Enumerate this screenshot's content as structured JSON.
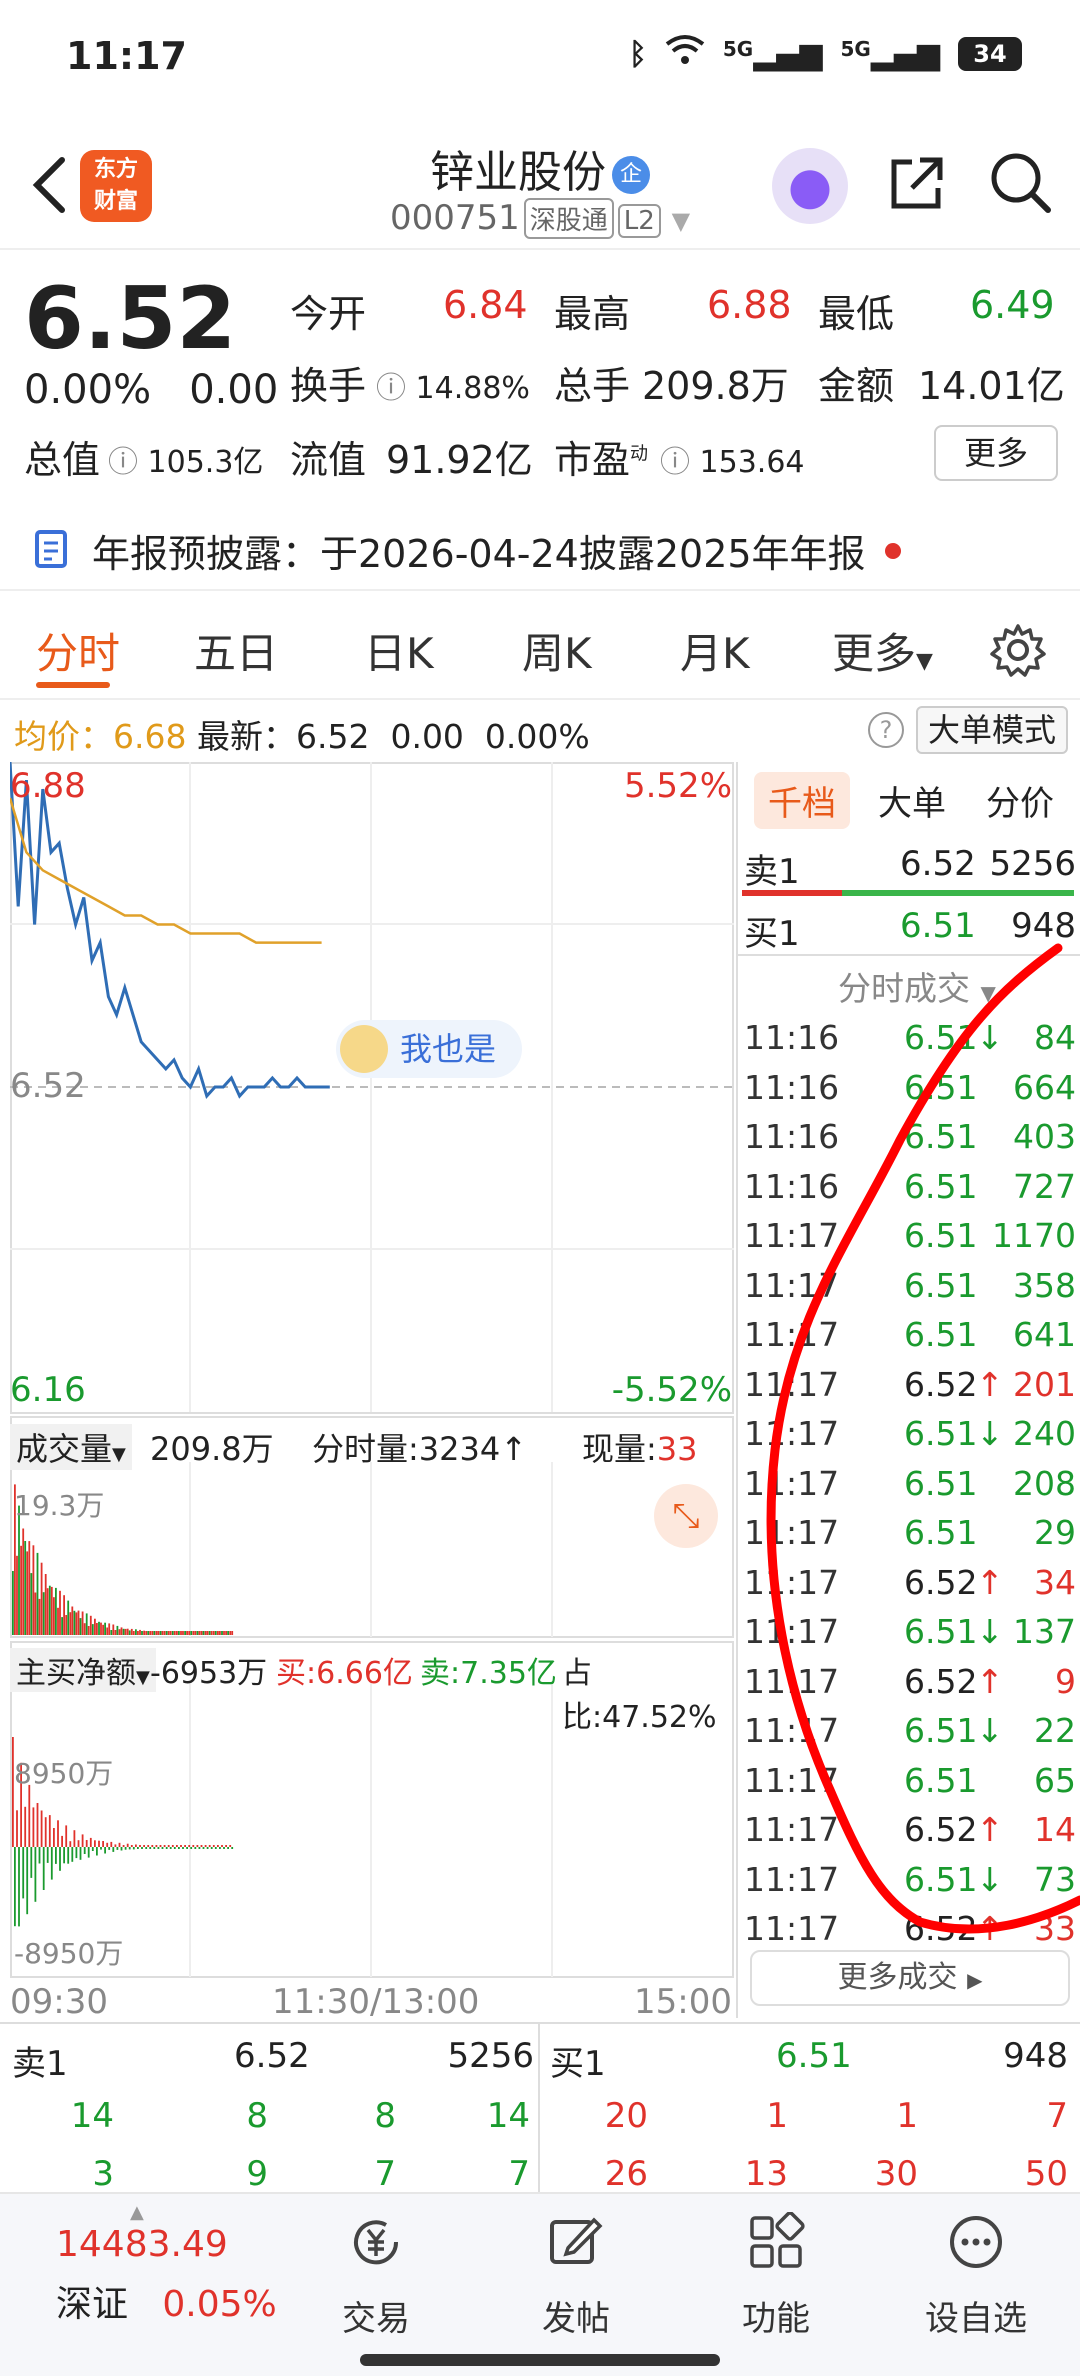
{
  "status_bar": {
    "time": "11:17",
    "signal1": "5G",
    "signal2": "5G",
    "battery": "34"
  },
  "header": {
    "logo_line1": "东方",
    "logo_line2": "财富",
    "stock_name": "锌业股份",
    "badge": "企",
    "stock_code": "000751",
    "market_tag": "深股通",
    "level_tag": "L2"
  },
  "quote": {
    "price": "6.52",
    "change_pct": "0.00%",
    "change": "0.00",
    "open_label": "今开",
    "open": "6.84",
    "high_label": "最高",
    "high": "6.88",
    "low_label": "最低",
    "low": "6.49",
    "turnover_label": "换手",
    "turnover": "14.88%",
    "volume_label": "总手",
    "volume": "209.8万",
    "amount_label": "金额",
    "amount": "14.01亿",
    "mktcap_label": "总值",
    "mktcap": "105.3亿",
    "float_label": "流值",
    "float": "91.92亿",
    "pe_label": "市盈",
    "pe_sup": "动",
    "pe": "153.64",
    "more": "更多"
  },
  "notice": {
    "text": "年报预披露：于2026-04-24披露2025年年报"
  },
  "tabs": [
    "分时",
    "五日",
    "日K",
    "周K",
    "月K",
    "更多"
  ],
  "avgbar": {
    "avg_label": "均价：",
    "avg": "6.68",
    "latest_label": "最新：",
    "latest": "6.52",
    "chg": "0.00",
    "pct": "0.00%",
    "mode_button": "大单模式"
  },
  "chart_labels": {
    "top_price": "6.88",
    "top_pct": "5.52%",
    "mid_price": "6.52",
    "bottom_price": "6.16",
    "bottom_pct": "-5.52%",
    "bubble": "我也是",
    "vol_selector": "成交量",
    "vol_total": "209.8万",
    "vol_minute": "分时量:3234↑",
    "vol_now_label": "现量:",
    "vol_now": "33",
    "vol_max": "19.3万",
    "flow_selector": "主买净额",
    "flow_net": "-6953万",
    "flow_buy": "买:6.66亿",
    "flow_sell": "卖:7.35亿",
    "flow_ratio": "占比:47.52%",
    "flow_top": "8950万",
    "flow_bottom": "-8950万",
    "time_start": "09:30",
    "time_mid": "11:30/13:00",
    "time_end": "15:00"
  },
  "chart_data": {
    "type": "line",
    "series": [
      {
        "values": [
          6.88,
          6.72,
          6.86,
          6.7,
          6.85,
          6.78,
          6.79,
          6.74,
          6.7,
          6.73,
          6.66,
          6.68,
          6.62,
          6.6,
          6.63,
          6.6,
          6.57,
          6.56,
          6.55,
          6.54,
          6.55,
          6.53,
          6.52,
          6.54,
          6.51,
          6.52,
          6.52,
          6.53,
          6.51,
          6.52,
          6.52,
          6.52,
          6.53,
          6.52,
          6.52,
          6.53,
          6.52,
          6.52,
          6.52,
          6.52
        ]
      },
      {
        "values": [
          6.84,
          6.78,
          6.76,
          6.75,
          6.74,
          6.73,
          6.72,
          6.71,
          6.71,
          6.7,
          6.7,
          6.69,
          6.69,
          6.69,
          6.69,
          6.68,
          6.68,
          6.68,
          6.68,
          6.68
        ]
      }
    ],
    "ylim": [
      6.16,
      6.88
    ],
    "x": [
      "09:30",
      "11:30/13:00",
      "15:00"
    ]
  },
  "right_panel": {
    "tabs": [
      "千档",
      "大单",
      "分价"
    ],
    "sell1": {
      "label": "卖1",
      "price": "6.52",
      "vol": "5256"
    },
    "buy1": {
      "label": "买1",
      "price": "6.51",
      "vol": "948"
    },
    "trades_header": "分时成交",
    "trades": [
      {
        "t": "11:16",
        "p": "6.51",
        "a": "↓",
        "v": "84",
        "c": "g"
      },
      {
        "t": "11:16",
        "p": "6.51",
        "a": "",
        "v": "664",
        "c": "g"
      },
      {
        "t": "11:16",
        "p": "6.51",
        "a": "",
        "v": "403",
        "c": "g"
      },
      {
        "t": "11:16",
        "p": "6.51",
        "a": "",
        "v": "727",
        "c": "g"
      },
      {
        "t": "11:17",
        "p": "6.51",
        "a": "",
        "v": "1170",
        "c": "g"
      },
      {
        "t": "11:17",
        "p": "6.51",
        "a": "",
        "v": "358",
        "c": "g"
      },
      {
        "t": "11:17",
        "p": "6.51",
        "a": "",
        "v": "641",
        "c": "g"
      },
      {
        "t": "11:17",
        "p": "6.52",
        "a": "↑",
        "v": "201",
        "c": "r"
      },
      {
        "t": "11:17",
        "p": "6.51",
        "a": "↓",
        "v": "240",
        "c": "g"
      },
      {
        "t": "11:17",
        "p": "6.51",
        "a": "",
        "v": "208",
        "c": "g"
      },
      {
        "t": "11:17",
        "p": "6.51",
        "a": "",
        "v": "29",
        "c": "g"
      },
      {
        "t": "11:17",
        "p": "6.52",
        "a": "↑",
        "v": "34",
        "c": "r"
      },
      {
        "t": "11:17",
        "p": "6.51",
        "a": "↓",
        "v": "137",
        "c": "g"
      },
      {
        "t": "11:17",
        "p": "6.52",
        "a": "↑",
        "v": "9",
        "c": "r"
      },
      {
        "t": "11:17",
        "p": "6.51",
        "a": "↓",
        "v": "22",
        "c": "g"
      },
      {
        "t": "11:17",
        "p": "6.51",
        "a": "",
        "v": "65",
        "c": "g"
      },
      {
        "t": "11:17",
        "p": "6.52",
        "a": "↑",
        "v": "14",
        "c": "r"
      },
      {
        "t": "11:17",
        "p": "6.51",
        "a": "↓",
        "v": "73",
        "c": "g"
      },
      {
        "t": "11:17",
        "p": "6.52",
        "a": "↑",
        "v": "33",
        "c": "r"
      }
    ],
    "more_trades": "更多成交"
  },
  "bottom_book": {
    "sell_label": "卖1",
    "sell_price": "6.52",
    "sell_vol": "5256",
    "buy_label": "买1",
    "buy_price": "6.51",
    "buy_vol": "948",
    "row1_left": [
      "14",
      "8",
      "8",
      "14"
    ],
    "row1_right": [
      "20",
      "1",
      "1",
      "7"
    ],
    "row2_left": [
      "3",
      "9",
      "7",
      "7"
    ],
    "row2_right": [
      "26",
      "13",
      "30",
      "50"
    ]
  },
  "bottom_nav": {
    "index_value": "14483.49",
    "index_name": "深证",
    "index_pct": "0.05%",
    "items": [
      "交易",
      "发帖",
      "功能",
      "设自选"
    ]
  }
}
